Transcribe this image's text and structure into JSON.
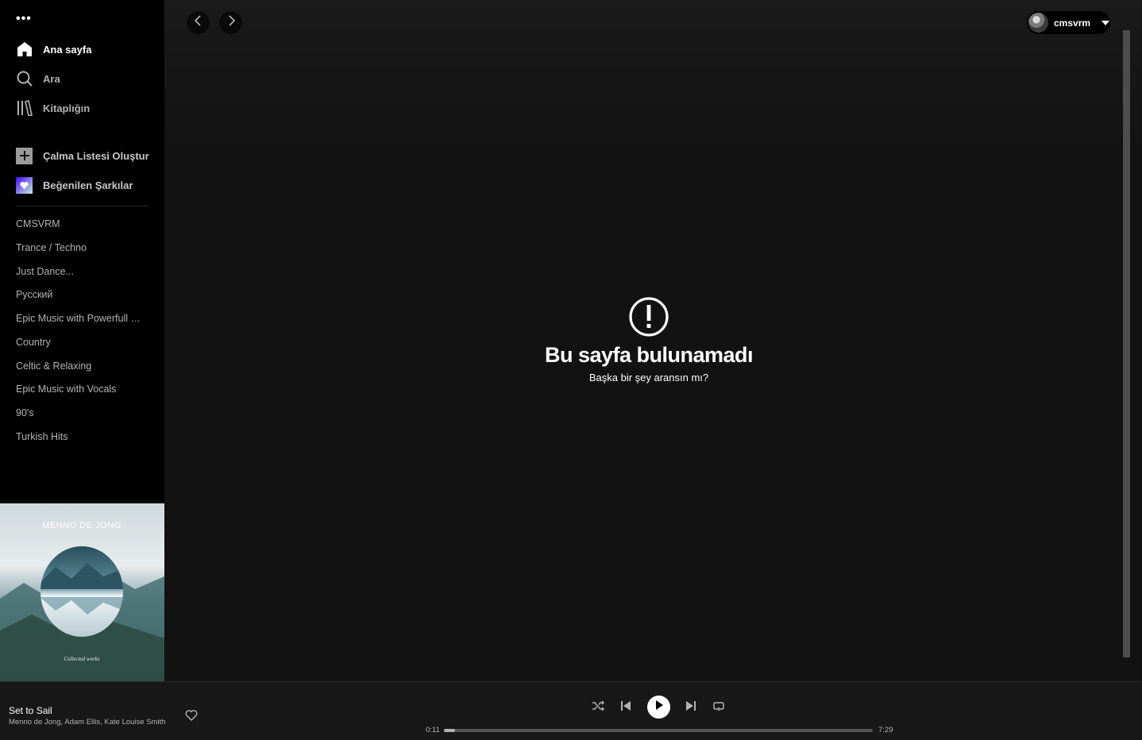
{
  "sidebar": {
    "menu_dots": "•••",
    "nav": [
      {
        "label": "Ana sayfa",
        "icon": "home-icon"
      },
      {
        "label": "Ara",
        "icon": "search-icon"
      },
      {
        "label": "Kitaplığın",
        "icon": "library-icon"
      }
    ],
    "actions": [
      {
        "label": "Çalma Listesi Oluştur",
        "icon": "plus-icon"
      },
      {
        "label": "Beğenilen Şarkılar",
        "icon": "heart-icon"
      }
    ],
    "playlists": [
      "CMSVRM",
      "Trance / Techno",
      "Just Dance...",
      "Русский",
      "Epic Music with Powerfull Choirs",
      "Country",
      "Celtic & Relaxing",
      "Epic Music with Vocals",
      "90's",
      "Turkish Hits"
    ],
    "cover_art": {
      "text": "MENNO DE JONG",
      "subtitle": "Collected works"
    }
  },
  "header": {
    "username": "cmsvrm"
  },
  "main": {
    "error_title": "Bu sayfa bulunamadı",
    "error_subtitle": "Başka bir şey aransın mı?"
  },
  "player": {
    "track_title": "Set to Sail",
    "track_artists": "Menno de Jong, Adam Ellis, Kate Louise Smith",
    "elapsed": "0:11",
    "duration": "7:29",
    "progress": 0.025
  },
  "colors": {
    "background": "#121212",
    "sidebar": "#000000",
    "player": "#181818",
    "text_muted": "#b3b3b3"
  }
}
